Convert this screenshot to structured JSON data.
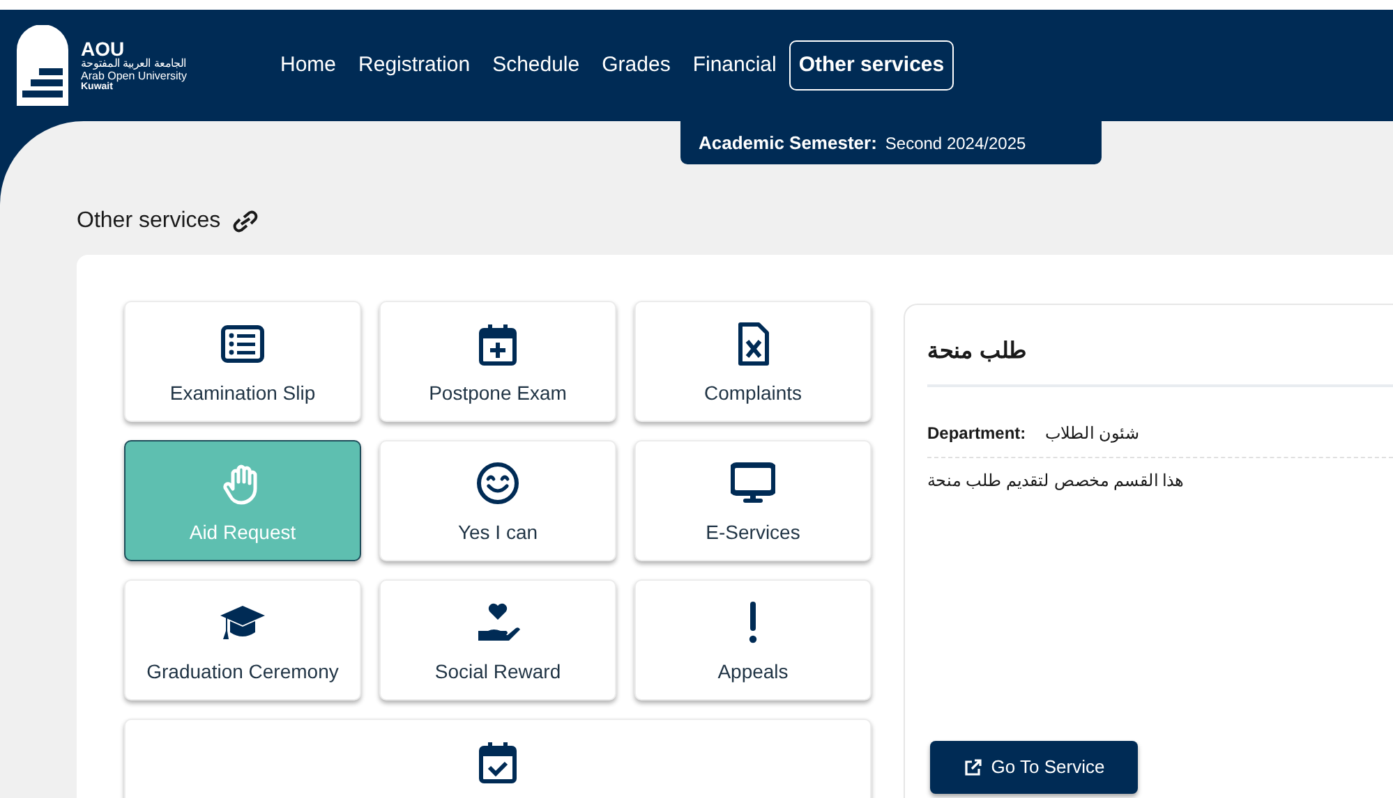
{
  "logo": {
    "abbr": "AOU",
    "arabic_name": "الجامعة العربية المفتوحة",
    "name": "Arab Open University",
    "branch": "Kuwait"
  },
  "nav": [
    {
      "label": "Home",
      "selected": false
    },
    {
      "label": "Registration",
      "selected": false
    },
    {
      "label": "Schedule",
      "selected": false
    },
    {
      "label": "Grades",
      "selected": false
    },
    {
      "label": "Financial",
      "selected": false
    },
    {
      "label": "Other services",
      "selected": true
    }
  ],
  "semester": {
    "label": "Academic Semester:",
    "value": "Second 2024/2025"
  },
  "page_title": "Other services",
  "tiles": [
    {
      "label": "Examination Slip",
      "selected": false
    },
    {
      "label": "Postpone Exam",
      "selected": false
    },
    {
      "label": "Complaints",
      "selected": false
    },
    {
      "label": "Aid Request",
      "selected": true
    },
    {
      "label": "Yes I can",
      "selected": false
    },
    {
      "label": "E-Services",
      "selected": false
    },
    {
      "label": "Graduation Ceremony",
      "selected": false
    },
    {
      "label": "Social Reward",
      "selected": false
    },
    {
      "label": "Appeals",
      "selected": false
    },
    {
      "selected": false
    }
  ],
  "detail": {
    "title": "طلب منحة",
    "department_label": "Department:",
    "department": "شئون الطلاب",
    "description": "هذا القسم مخصص لتقديم طلب منحة",
    "button": "Go To Service"
  }
}
